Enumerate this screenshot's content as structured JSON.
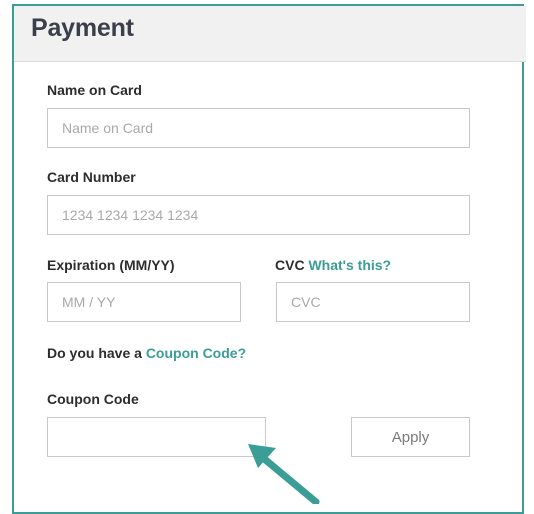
{
  "payment": {
    "title": "Payment",
    "name_on_card": {
      "label": "Name on Card",
      "placeholder": "Name on Card",
      "value": ""
    },
    "card_number": {
      "label": "Card Number",
      "placeholder": "1234 1234 1234 1234",
      "value": ""
    },
    "expiration": {
      "label": "Expiration (MM/YY)",
      "placeholder": "MM / YY",
      "value": ""
    },
    "cvc": {
      "label": "CVC",
      "help_link": "What's this?",
      "placeholder": "CVC",
      "value": ""
    },
    "coupon_prompt": {
      "text": "Do you have a",
      "link": "Coupon Code?"
    },
    "coupon": {
      "label": "Coupon Code",
      "placeholder": "",
      "value": ""
    },
    "apply_label": "Apply"
  },
  "annotation": {
    "icon": "arrow-pointer-icon",
    "color": "#3a9e96"
  },
  "colors": {
    "accent": "#3a9e96",
    "heading": "#3b3f4a",
    "border": "#c9c9c9"
  }
}
